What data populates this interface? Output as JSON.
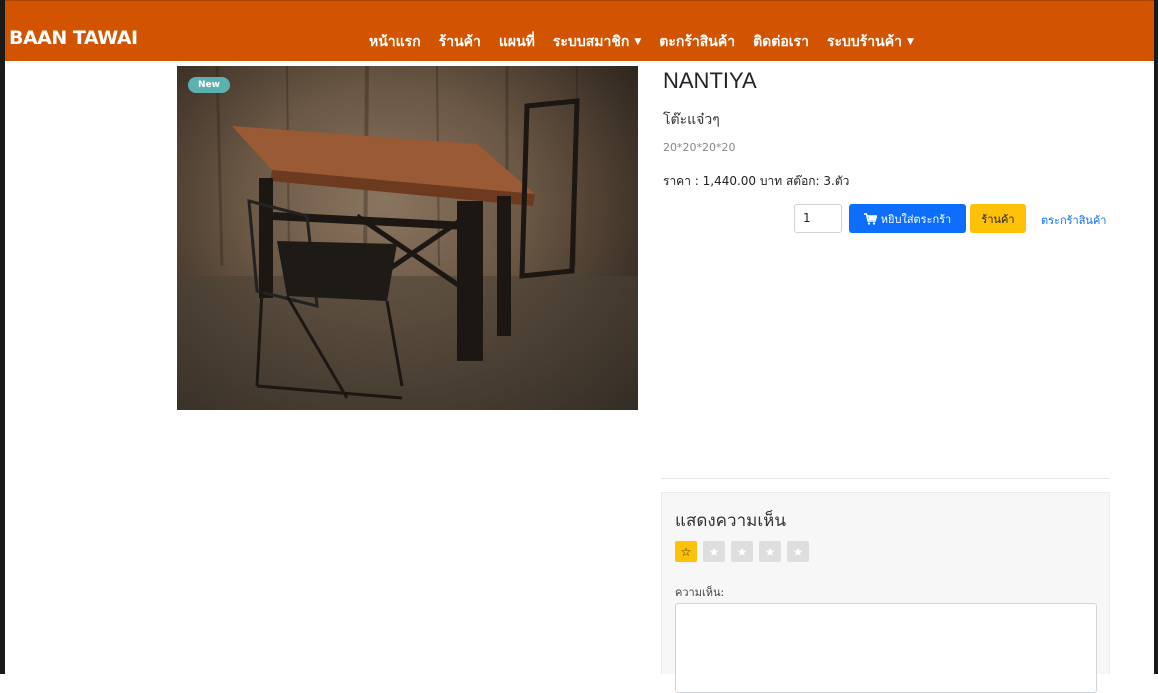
{
  "navbar": {
    "brand": "BAAN TAWAI",
    "items": [
      {
        "label": "หน้าแรก",
        "dropdown": false
      },
      {
        "label": "ร้านค้า",
        "dropdown": false
      },
      {
        "label": "แผนที่",
        "dropdown": false
      },
      {
        "label": "ระบบสมาชิก",
        "dropdown": true
      },
      {
        "label": "ตะกร้าสินค้า",
        "dropdown": false
      },
      {
        "label": "ติดต่อเรา",
        "dropdown": false
      },
      {
        "label": "ระบบร้านค้า",
        "dropdown": true
      }
    ],
    "caret": "▼"
  },
  "product": {
    "badge": "New",
    "name": "NANTIYA",
    "subtitle": "โต๊ะแจ๋วๆ",
    "dimensions": "20*20*20*20",
    "price_line": "ราคา : 1,440.00 บาท  สต๊อก: 3.ตัว",
    "quantity": "1",
    "add_to_cart_label": "หยิบใส่ตระกร้า",
    "shop_label": "ร้านค้า",
    "cart_link_label": "ตระกร้าสินค้า"
  },
  "comments": {
    "title": "แสดงความเห็น",
    "rating": 1,
    "stars": [
      "☆",
      "★",
      "★",
      "★",
      "★"
    ],
    "label": "ความเห็น:",
    "textarea_value": ""
  },
  "colors": {
    "navbar": "#d35400",
    "primary_button": "#0d6efd",
    "warning_button": "#ffc107",
    "badge": "#5bb0b0"
  }
}
